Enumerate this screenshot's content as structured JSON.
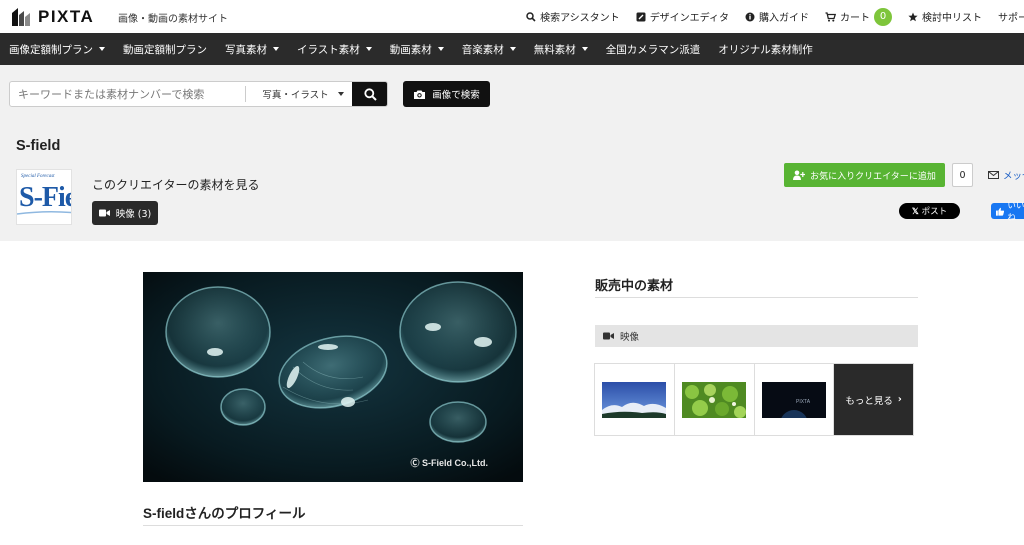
{
  "header": {
    "logo_text": "PIXTA",
    "tagline": "画像・動画の素材サイト",
    "links": {
      "search_assistant": "検索アシスタント",
      "design_editor": "デザインエディタ",
      "purchase_guide": "購入ガイド",
      "cart": "カート",
      "cart_count": "0",
      "watchlist": "検討中リスト",
      "support": "サポート"
    }
  },
  "nav": {
    "items": [
      {
        "label": "画像定額制プラン",
        "dropdown": true
      },
      {
        "label": "動画定額制プラン",
        "dropdown": false
      },
      {
        "label": "写真素材",
        "dropdown": true
      },
      {
        "label": "イラスト素材",
        "dropdown": true
      },
      {
        "label": "動画素材",
        "dropdown": true
      },
      {
        "label": "音楽素材",
        "dropdown": true
      },
      {
        "label": "無料素材",
        "dropdown": true
      },
      {
        "label": "全国カメラマン派遣",
        "dropdown": false
      },
      {
        "label": "オリジナル素材制作",
        "dropdown": false
      }
    ]
  },
  "search": {
    "placeholder": "キーワードまたは素材ナンバーで検索",
    "category": "写真・イラスト",
    "image_search_label": "画像で検索"
  },
  "creator": {
    "name": "S-field",
    "avatar_small": "Special Forecast",
    "avatar_big": "S-Field",
    "view_materials": "このクリエイターの素材を見る",
    "video_button": "映像 (3)",
    "favorite_button": "お気に入りクリエイターに追加",
    "favorite_count": "0",
    "message": "メッセージ",
    "x_post": "ポスト",
    "fb_like": "いいね"
  },
  "main": {
    "hero_credit": "Ⓒ S-Field Co.,Ltd.",
    "profile_heading": "S-fieldさんのプロフィール"
  },
  "sidebar": {
    "on_sale_heading": "販売中の素材",
    "category_label": "映像",
    "more_label": "もっと見る",
    "thumb3_watermark": "PIXTA"
  },
  "colors": {
    "nav_bg": "#2b2b2b",
    "accent_green": "#58b433",
    "cart_badge": "#7ec53b",
    "link_blue": "#1a5ec5",
    "fb_blue": "#1877f2"
  }
}
